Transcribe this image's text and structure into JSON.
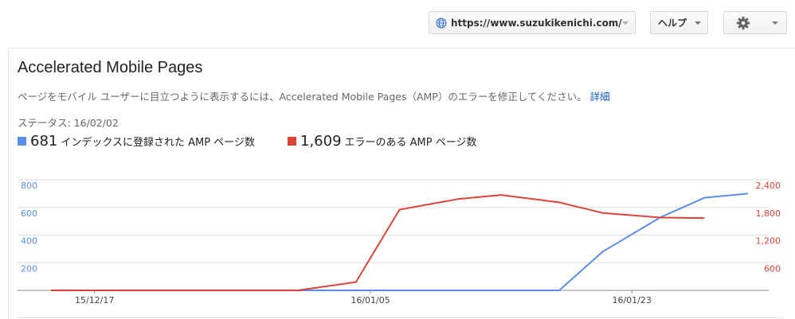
{
  "toolbar": {
    "site_url": "https://www.suzukikenichi.com/blog/",
    "help_label": "ヘルプ",
    "icons": {
      "site": "globe-icon",
      "settings": "gear-icon"
    }
  },
  "page": {
    "title": "Accelerated Mobile Pages",
    "description": "ページをモバイル ユーザーに目立つように表示するには、Accelerated Mobile Pages（AMP）のエラーを修正してください。",
    "details_link": "詳細",
    "status": "ステータス: 16/02/02"
  },
  "legend": {
    "indexed": {
      "value": "681",
      "label": "インデックスに登録された AMP ページ数",
      "color": "#5b8def"
    },
    "errors": {
      "value": "1,609",
      "label": "エラーのある AMP ページ数",
      "color": "#db4437"
    }
  },
  "chart_data": {
    "type": "line",
    "x_tick_labels": [
      "15/12/17",
      "16/01/05",
      "16/01/23"
    ],
    "x_ticks_at": [
      "2015-12-17",
      "2016-01-05",
      "2016-01-23"
    ],
    "x": [
      "2015-12-14",
      "2015-12-17",
      "2015-12-21",
      "2015-12-24",
      "2015-12-28",
      "2015-12-31",
      "2016-01-04",
      "2016-01-07",
      "2016-01-11",
      "2016-01-14",
      "2016-01-18",
      "2016-01-21",
      "2016-01-25",
      "2016-01-28",
      "2016-01-31"
    ],
    "series": [
      {
        "axis": "left",
        "color": "#5b8def",
        "values": [
          0,
          0,
          0,
          0,
          0,
          0,
          0,
          0,
          0,
          0,
          0,
          280,
          530,
          670,
          700
        ]
      },
      {
        "axis": "right",
        "color": "#db4437",
        "values": [
          0,
          0,
          0,
          0,
          0,
          0,
          180,
          1750,
          1980,
          2070,
          1910,
          1680,
          1580,
          1570,
          null
        ]
      }
    ],
    "y_left": {
      "ticks": [
        "800",
        "600",
        "400",
        "200"
      ],
      "range": [
        0,
        800
      ],
      "color": "#5b8def"
    },
    "y_right": {
      "ticks": [
        "2,400",
        "1,800",
        "1,200",
        "600"
      ],
      "range": [
        0,
        2400
      ],
      "color": "#db4437"
    },
    "grid": true
  }
}
